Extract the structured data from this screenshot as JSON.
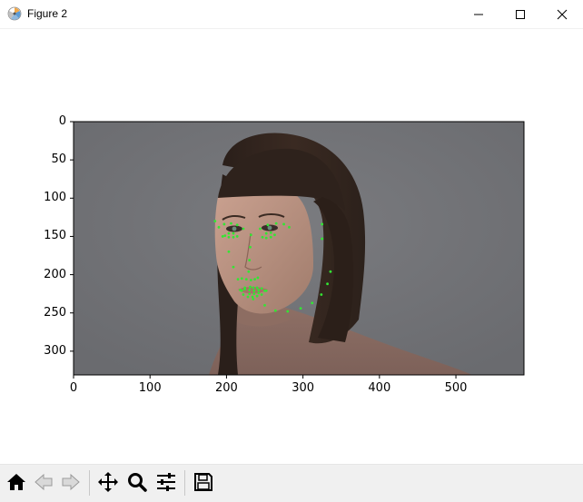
{
  "window": {
    "title": "Figure 2",
    "buttons": [
      "minimize",
      "maximize",
      "close"
    ]
  },
  "chart_data": {
    "type": "image",
    "xlim": [
      0,
      589
    ],
    "ylim": [
      0,
      331
    ],
    "y_inverted": true,
    "xticks": [
      "0",
      "100",
      "200",
      "300",
      "400",
      "500"
    ],
    "yticks": [
      "0",
      "50",
      "100",
      "150",
      "200",
      "250",
      "300"
    ],
    "title": "",
    "xlabel": "",
    "ylabel": "",
    "grid": false,
    "landmark_color": "#33e633",
    "landmarks": [
      [
        185,
        130
      ],
      [
        195,
        150
      ],
      [
        203,
        170
      ],
      [
        209,
        190
      ],
      [
        215,
        206
      ],
      [
        224,
        219
      ],
      [
        235,
        232
      ],
      [
        250,
        240
      ],
      [
        264,
        247
      ],
      [
        280,
        248
      ],
      [
        297,
        244
      ],
      [
        312,
        237
      ],
      [
        324,
        226
      ],
      [
        332,
        212
      ],
      [
        336,
        196
      ],
      [
        325,
        134
      ],
      [
        325,
        153
      ],
      [
        190,
        138
      ],
      [
        197,
        134
      ],
      [
        206,
        133
      ],
      [
        214,
        135
      ],
      [
        222,
        140
      ],
      [
        244,
        140
      ],
      [
        254,
        135
      ],
      [
        265,
        133
      ],
      [
        275,
        134
      ],
      [
        282,
        138
      ],
      [
        232,
        148
      ],
      [
        231,
        164
      ],
      [
        230,
        181
      ],
      [
        229,
        196
      ],
      [
        220,
        205
      ],
      [
        226,
        206
      ],
      [
        232,
        207
      ],
      [
        237,
        206
      ],
      [
        241,
        204
      ],
      [
        198,
        149
      ],
      [
        203,
        146
      ],
      [
        209,
        146
      ],
      [
        214,
        150
      ],
      [
        209,
        151
      ],
      [
        203,
        151
      ],
      [
        247,
        151
      ],
      [
        252,
        146
      ],
      [
        258,
        145
      ],
      [
        263,
        148
      ],
      [
        258,
        151
      ],
      [
        252,
        152
      ],
      [
        218,
        220
      ],
      [
        224,
        217
      ],
      [
        231,
        216
      ],
      [
        235,
        217
      ],
      [
        240,
        217
      ],
      [
        246,
        218
      ],
      [
        252,
        221
      ],
      [
        246,
        226
      ],
      [
        240,
        228
      ],
      [
        234,
        229
      ],
      [
        228,
        229
      ],
      [
        222,
        226
      ],
      [
        220,
        221
      ],
      [
        230,
        220
      ],
      [
        236,
        221
      ],
      [
        242,
        220
      ],
      [
        250,
        221
      ],
      [
        242,
        224
      ],
      [
        236,
        225
      ],
      [
        230,
        225
      ]
    ]
  },
  "toolbar": {
    "items": [
      {
        "name": "home-button",
        "icon": "home-icon"
      },
      {
        "name": "back-button",
        "icon": "back-arrow-icon"
      },
      {
        "name": "forward-button",
        "icon": "forward-arrow-icon"
      },
      {
        "name": "pan-button",
        "icon": "move-icon"
      },
      {
        "name": "zoom-button",
        "icon": "magnifier-icon"
      },
      {
        "name": "subplots-button",
        "icon": "sliders-icon"
      },
      {
        "name": "save-button",
        "icon": "floppy-disk-icon"
      }
    ]
  }
}
